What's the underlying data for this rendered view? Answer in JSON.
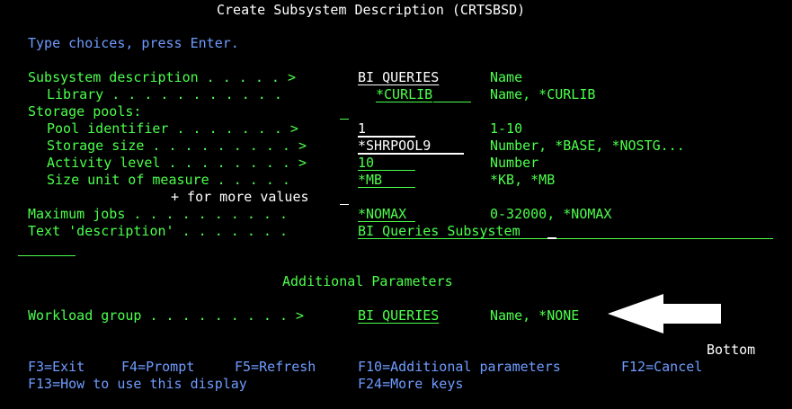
{
  "title": "Create Subsystem Description (CRTSBSD)",
  "instruction": "Type choices, press Enter.",
  "params": {
    "subsystem_description": {
      "label": "Subsystem description . . . . . >",
      "value": "BI_QUERIES",
      "hint": "Name"
    },
    "library": {
      "label": "Library . . . . . . . . . . .",
      "value": "*CURLIB",
      "hint": "Name, *CURLIB"
    },
    "storage_pools": {
      "label": "Storage pools:"
    },
    "pool_identifier": {
      "label": "Pool identifier . . . . . . . >",
      "value": "1",
      "hint": "1-10"
    },
    "storage_size": {
      "label": "Storage size . . . . . . . . . >",
      "value": "*SHRPOOL9",
      "hint": "Number, *BASE, *NOSTG..."
    },
    "activity_level": {
      "label": "Activity level . . . . . . . . >",
      "value": "10",
      "hint": "Number"
    },
    "size_unit": {
      "label": "Size unit of measure . . . . .",
      "value": "*MB",
      "hint": "*KB, *MB"
    },
    "more_values": {
      "label": "+ for more values"
    },
    "maximum_jobs": {
      "label": "Maximum jobs . . . . . . . . . .",
      "value": "*NOMAX",
      "hint": "0-32000, *NOMAX"
    },
    "text_description": {
      "label": "Text 'description' . . . . . . .",
      "value": "BI Queries Subsystem"
    }
  },
  "additional_header": "Additional Parameters",
  "workload_group": {
    "label": "Workload group . . . . . . . . . >",
    "value": "BI_QUERIES",
    "hint": "Name, *NONE"
  },
  "bottom": "Bottom",
  "fkeys_row1": [
    "F3=Exit",
    "F4=Prompt",
    "F5=Refresh",
    "F10=Additional parameters",
    "F12=Cancel"
  ],
  "fkeys_row2": [
    "F13=How to use this display",
    "F24=More keys"
  ],
  "colors": {
    "white": "#ffffff",
    "green": "#4cff4c",
    "blue": "#6f9cff"
  },
  "icons": {
    "pointer": "left-arrow-icon"
  }
}
